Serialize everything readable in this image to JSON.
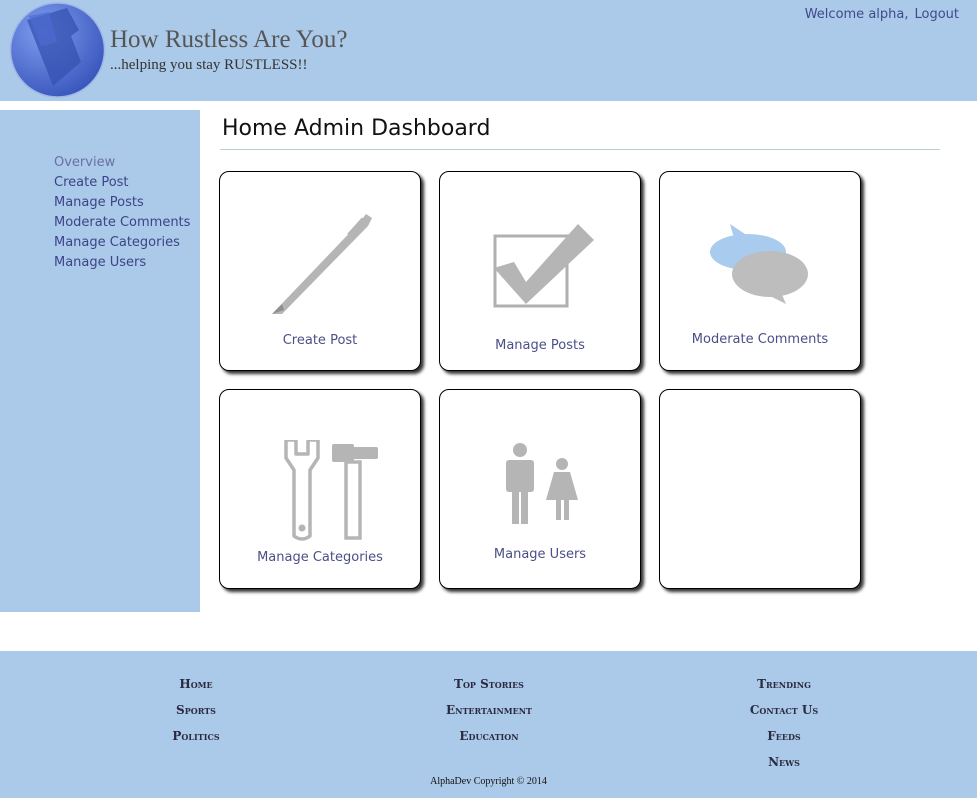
{
  "header": {
    "title": "How Rustless Are You?",
    "tagline": "...helping you stay RUSTLESS!!",
    "welcome": "Welcome alpha,",
    "logout": "Logout"
  },
  "sidebar": {
    "items": [
      {
        "label": "Overview"
      },
      {
        "label": "Create Post"
      },
      {
        "label": "Manage Posts"
      },
      {
        "label": "Moderate Comments"
      },
      {
        "label": "Manage Categories"
      },
      {
        "label": "Manage Users"
      }
    ]
  },
  "main": {
    "title": "Home Admin Dashboard",
    "tiles": [
      {
        "label": "Create Post",
        "icon": "pen-icon"
      },
      {
        "label": "Manage Posts",
        "icon": "checkbox-icon"
      },
      {
        "label": "Moderate Comments",
        "icon": "speech-bubbles-icon"
      },
      {
        "label": "Manage Categories",
        "icon": "wrench-hammer-icon"
      },
      {
        "label": "Manage Users",
        "icon": "users-icon"
      },
      {
        "label": "",
        "icon": ""
      }
    ]
  },
  "footer": {
    "col1": [
      "Home",
      "Sports",
      "Politics"
    ],
    "col2": [
      "Top Stories",
      "Entertainment",
      "Education"
    ],
    "col3": [
      "Trending",
      "Contact Us",
      "Feeds",
      "News"
    ],
    "copyright": "AlphaDev Copyright © 2014"
  },
  "colors": {
    "header_bg": "#abc9e8",
    "link": "#3c4488",
    "icon_gray": "#bdbdbd"
  }
}
